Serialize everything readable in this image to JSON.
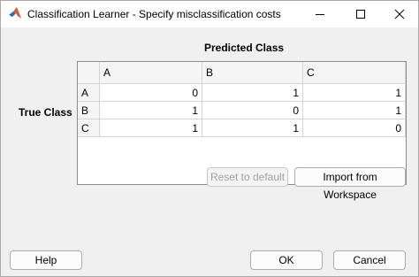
{
  "window": {
    "title": "Classification Learner - Specify misclassification costs"
  },
  "labels": {
    "predicted": "Predicted Class",
    "true": "True Class"
  },
  "table": {
    "columns": [
      "A",
      "B",
      "C"
    ],
    "rows": [
      {
        "label": "A",
        "values": [
          "0",
          "1",
          "1"
        ]
      },
      {
        "label": "B",
        "values": [
          "1",
          "0",
          "1"
        ]
      },
      {
        "label": "C",
        "values": [
          "1",
          "1",
          "0"
        ]
      }
    ]
  },
  "buttons": {
    "reset": "Reset to default",
    "import": "Import from Workspace",
    "help": "Help",
    "ok": "OK",
    "cancel": "Cancel"
  },
  "icons": {
    "app": "matlab-logo-icon",
    "minimize": "minimize-icon",
    "maximize": "maximize-icon",
    "close": "close-icon"
  }
}
